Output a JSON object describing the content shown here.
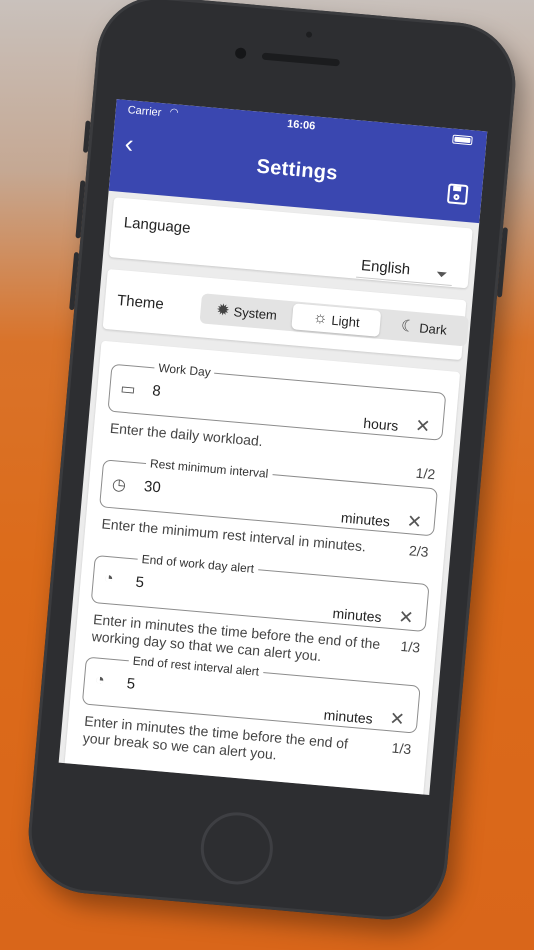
{
  "status": {
    "carrier": "Carrier",
    "time": "16:06"
  },
  "header": {
    "title": "Settings",
    "back_icon": "chevron-left-icon",
    "save_icon": "save-icon"
  },
  "language": {
    "label": "Language",
    "selected": "English"
  },
  "theme": {
    "label": "Theme",
    "options": [
      {
        "label": "System",
        "icon": "brightness-auto-icon",
        "active": false
      },
      {
        "label": "Light",
        "icon": "sun-icon",
        "active": true
      },
      {
        "label": "Dark",
        "icon": "moon-icon",
        "active": false
      }
    ]
  },
  "fields": [
    {
      "legend": "Work Day",
      "icon": "briefcase-icon",
      "value": "8",
      "unit": "hours",
      "helper": "Enter the daily workload.",
      "counter": "1/2"
    },
    {
      "legend": "Rest minimum interval",
      "icon": "timer-icon",
      "value": "30",
      "unit": "minutes",
      "helper": "Enter the minimum rest interval in minutes.",
      "counter": "2/3"
    },
    {
      "legend": "End of work day alert",
      "icon": "clock-alert-icon",
      "value": "5",
      "unit": "minutes",
      "helper": "Enter in minutes the time before the end of the working day so that we can alert you.",
      "counter": "1/3"
    },
    {
      "legend": "End of rest interval alert",
      "icon": "clock-alert-icon",
      "value": "5",
      "unit": "minutes",
      "helper": "Enter in minutes the time before the end of your break so we can alert you.",
      "counter": "1/3"
    }
  ],
  "colors": {
    "appbar": "#3a47b0",
    "background": "#dc6b1a"
  }
}
